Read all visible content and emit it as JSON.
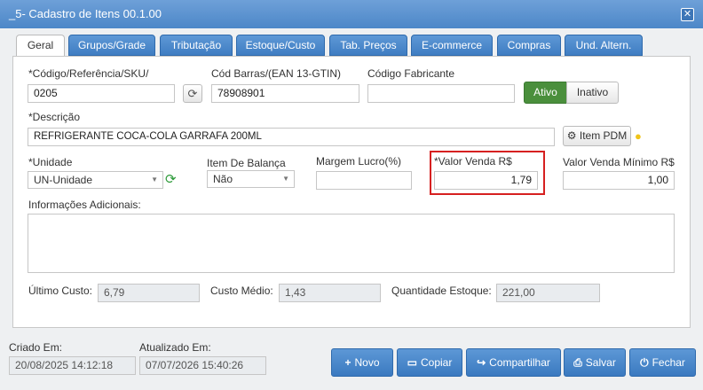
{
  "window": {
    "title": "_5- Cadastro de Itens 00.1.00"
  },
  "tabs": [
    "Geral",
    "Grupos/Grade",
    "Tributação",
    "Estoque/Custo",
    "Tab. Preços",
    "E-commerce",
    "Compras",
    "Und. Altern."
  ],
  "form": {
    "codigo_label": "*Código/Referência/SKU/",
    "codigo_value": "0205",
    "barras_label": "Cód Barras/(EAN 13-GTIN)",
    "barras_value": "78908901",
    "fabricante_label": "Código Fabricante",
    "fabricante_value": "",
    "status_ativo": "Ativo",
    "status_inativo": "Inativo",
    "descricao_label": "*Descrição",
    "descricao_value": "REFRIGERANTE COCA-COLA GARRAFA 200ML",
    "item_pdm_label": "Item PDM",
    "unidade_label": "*Unidade",
    "unidade_value": "UN-Unidade",
    "balanca_label": "Item De Balança",
    "balanca_value": "Não",
    "margem_label": "Margem Lucro(%)",
    "margem_value": "",
    "valor_venda_label": "*Valor Venda R$",
    "valor_venda_value": "1,79",
    "valor_min_label": "Valor Venda Mínimo R$",
    "valor_min_value": "1,00",
    "info_label": "Informações Adicionais:",
    "ultimo_custo_label": "Último Custo:",
    "ultimo_custo_value": "6,79",
    "custo_medio_label": "Custo Médio:",
    "custo_medio_value": "1,43",
    "qtd_estoque_label": "Quantidade Estoque:",
    "qtd_estoque_value": "221,00"
  },
  "footer": {
    "criado_label": "Criado Em:",
    "criado_value": "20/08/2025 14:12:18",
    "atualizado_label": "Atualizado Em:",
    "atualizado_value": "07/07/2026 15:40:26",
    "buttons": {
      "novo": "Novo",
      "copiar": "Copiar",
      "compartilhar": "Compartilhar",
      "salvar": "Salvar",
      "fechar": "Fechar"
    }
  },
  "colors": {
    "accent": "#4c87c8",
    "active_green": "#4a8f3c",
    "highlight_red": "#d62020"
  }
}
